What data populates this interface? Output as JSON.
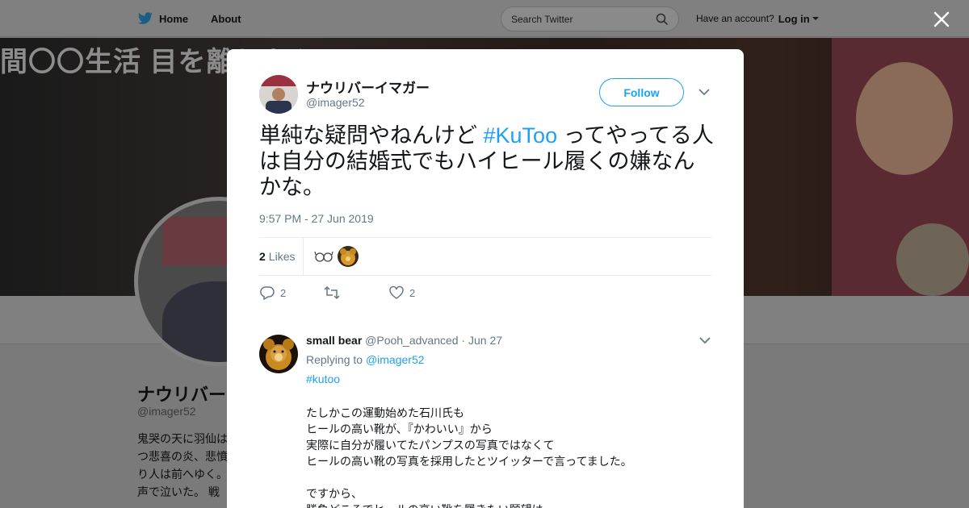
{
  "topbar": {
    "home_label": "Home",
    "about_label": "About",
    "search_placeholder": "Search Twitter",
    "have_account": "Have an account?",
    "login_label": "Log in"
  },
  "background_profile": {
    "banner_text": "間〇〇生活 目を離したら...",
    "name": "ナウリバーイ",
    "handle": "@imager52",
    "bio_lines": [
      "鬼哭の天に羽仙は",
      "つ悲喜の炎、悲憤",
      "り人は前へゆく。",
      "声で泣いた。 戦え"
    ]
  },
  "tweet": {
    "author_name": "ナウリバーイマガー",
    "author_handle": "@imager52",
    "follow_label": "Follow",
    "text_before": "単純な疑問やねんけど ",
    "hashtag": "#KuToo",
    "text_after": " ってやってる人は自分の結婚式でもハイヒール履くの嫌なんかな。",
    "timestamp": "9:57 PM - 27 Jun 2019",
    "likes_count": "2",
    "likes_label": "Likes",
    "reply_count": "2",
    "like_count": "2"
  },
  "reply": {
    "name": "small bear",
    "handle": "@Pooh_advanced",
    "date": "· Jun 27",
    "replying_to_label": "Replying to",
    "replying_to_handle": "@imager52",
    "hashtag": "#kutoo",
    "lines": [
      "たしかこの運動始めた石川氏も",
      "ヒールの高い靴が、『かわいい』から",
      "実際に自分が履いてたパンプスの写真ではなくて",
      "ヒールの高い靴の写真を採用したとツイッターで言ってました。",
      "",
      "ですから、",
      "勝負どころでヒールの高い靴を履きたい願望は"
    ]
  },
  "colors": {
    "accent": "#1da1f2",
    "secondary_text": "#657786",
    "overlay_bg": "#808080"
  }
}
